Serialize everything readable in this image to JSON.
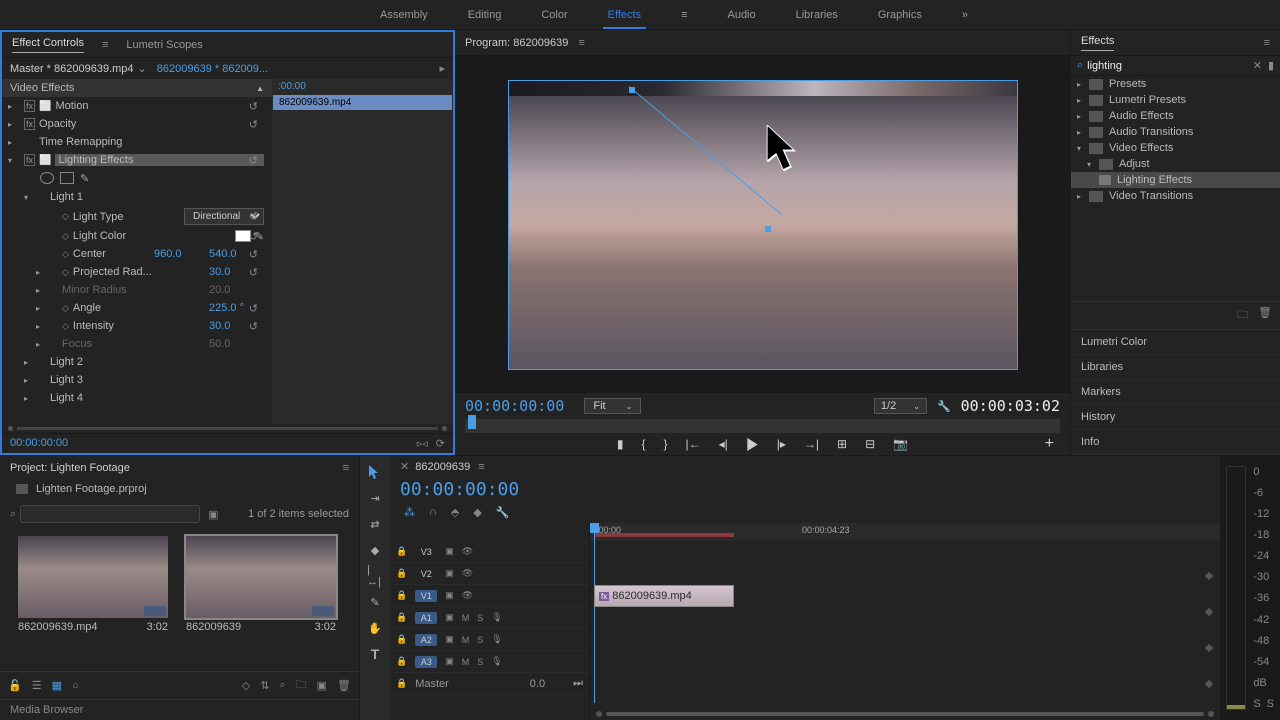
{
  "workspace_tabs": [
    "Assembly",
    "Editing",
    "Color",
    "Effects",
    "Audio",
    "Libraries",
    "Graphics"
  ],
  "workspace_active": "Effects",
  "effect_controls": {
    "tab_effect_controls": "Effect Controls",
    "tab_lumetri_scopes": "Lumetri Scopes",
    "master_label": "Master * 862009639.mp4",
    "clip_label": "862009639 * 862009...",
    "timecode_start": ":00:00",
    "clip_name": "862009639.mp4",
    "section_video_effects": "Video Effects",
    "fx_motion": "Motion",
    "fx_opacity": "Opacity",
    "fx_time_remapping": "Time Remapping",
    "fx_lighting": "Lighting Effects",
    "light1": "Light 1",
    "light_type_label": "Light Type",
    "light_type_value": "Directional",
    "light_color_label": "Light Color",
    "center_label": "Center",
    "center_x": "960.0",
    "center_y": "540.0",
    "proj_rad_label": "Projected Rad...",
    "proj_rad_value": "30.0",
    "minor_radius_label": "Minor Radius",
    "minor_radius_value": "20.0",
    "angle_label": "Angle",
    "angle_value": "225.0 °",
    "intensity_label": "Intensity",
    "intensity_value": "30.0",
    "focus_label": "Focus",
    "focus_value": "50.0",
    "light2": "Light 2",
    "light3": "Light 3",
    "light4": "Light 4",
    "footer_time": "00:00:00:00"
  },
  "program": {
    "title": "Program: 862009639",
    "timecode": "00:00:00:00",
    "fit": "Fit",
    "scale": "1/2",
    "duration": "00:00:03:02"
  },
  "effects_panel": {
    "title": "Effects",
    "search": "lighting",
    "presets": "Presets",
    "lumetri_presets": "Lumetri Presets",
    "audio_effects": "Audio Effects",
    "audio_transitions": "Audio Transitions",
    "video_effects": "Video Effects",
    "adjust": "Adjust",
    "lighting_effects": "Lighting Effects",
    "video_transitions": "Video Transitions"
  },
  "right_panels": [
    "Lumetri Color",
    "Libraries",
    "Markers",
    "History",
    "Info"
  ],
  "project": {
    "title": "Project: Lighten Footage",
    "file": "Lighten Footage.prproj",
    "count": "1 of 2 items selected",
    "bin1_name": "862009639.mp4",
    "bin1_dur": "3:02",
    "bin2_name": "862009639",
    "bin2_dur": "3:02",
    "media_browser": "Media Browser"
  },
  "timeline": {
    "title": "862009639",
    "timecode": "00:00:00:00",
    "tick0": ":00:00",
    "tick1": "00:00:04:23",
    "v3": "V3",
    "v2": "V2",
    "v1": "V1",
    "a1": "A1",
    "a2": "A2",
    "a3": "A3",
    "m": "M",
    "s": "S",
    "master": "Master",
    "master_val": "0.0",
    "clip_name": "862009639.mp4"
  },
  "meters": {
    "scale": [
      "0",
      "-6",
      "-12",
      "-18",
      "-24",
      "-30",
      "-36",
      "-42",
      "-48",
      "-54",
      "dB"
    ],
    "s": "S"
  }
}
